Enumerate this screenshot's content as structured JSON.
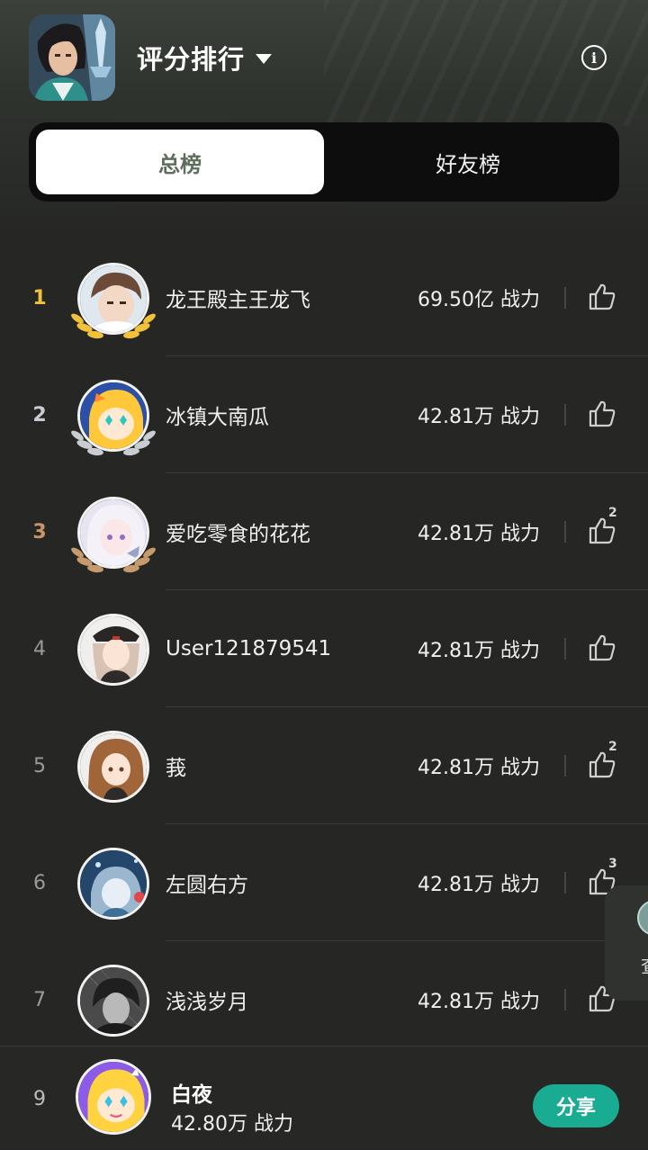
{
  "header": {
    "title": "评分排行",
    "game_icon": "game-character-icon",
    "info_icon": "info-icon"
  },
  "tabs": [
    {
      "label": "总榜",
      "active": true
    },
    {
      "label": "好友榜",
      "active": false
    }
  ],
  "colors": {
    "rank_1": "#f2c13a",
    "rank_2": "#c9ccd0",
    "rank_3": "#c9956b",
    "rank_other": "#9a9b96",
    "laurel_gold": "#f2c13a",
    "laurel_silver": "#c9ccd0",
    "laurel_bronze": "#c79a6e",
    "share_button": "#1aab93"
  },
  "ranking": [
    {
      "rank": "1",
      "name": "龙王殿主王龙飞",
      "power": "69.50亿 战力",
      "likes": "",
      "avatar": "boy-portrait-avatar"
    },
    {
      "rank": "2",
      "name": "冰镇大南瓜",
      "power": "42.81万 战力",
      "likes": "",
      "avatar": "cartoon-star-girl-avatar"
    },
    {
      "rank": "3",
      "name": "爱吃零食的花花",
      "power": "42.81万 战力",
      "likes": "2",
      "avatar": "anime-white-hair-girl-avatar"
    },
    {
      "rank": "4",
      "name": "User121879541",
      "power": "42.81万 战力",
      "likes": "",
      "avatar": "anime-military-girl-avatar"
    },
    {
      "rank": "5",
      "name": "莪",
      "power": "42.81万 战力",
      "likes": "2",
      "avatar": "anime-brown-hair-girl-avatar"
    },
    {
      "rank": "6",
      "name": "左圆右方",
      "power": "42.81万 战力",
      "likes": "3",
      "avatar": "anime-blue-night-avatar"
    },
    {
      "rank": "7",
      "name": "浅浅岁月",
      "power": "42.81万 战力",
      "likes": "",
      "avatar": "dark-rain-boy-avatar"
    }
  ],
  "side_bubble": {
    "text": "查",
    "icon": "character-face-icon"
  },
  "me": {
    "rank": "9",
    "name": "白夜",
    "power": "42.80万 战力",
    "avatar": "cartoon-star-girl-avatar",
    "share_label": "分享"
  }
}
